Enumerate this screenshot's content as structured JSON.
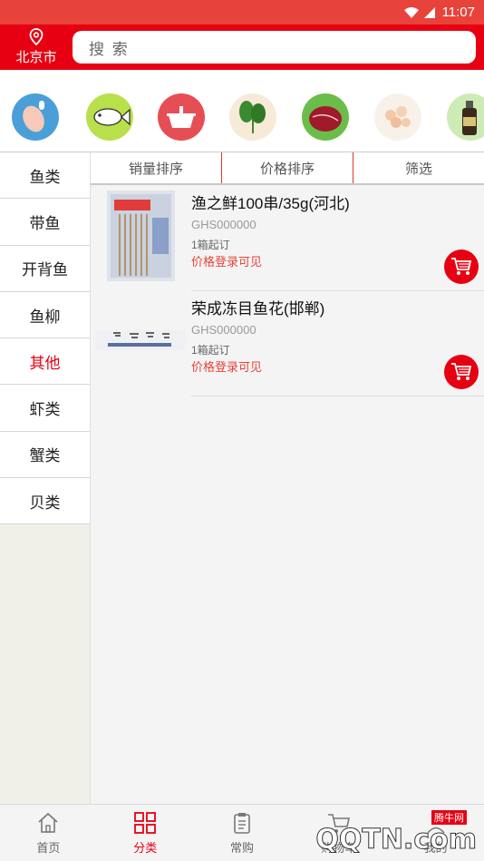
{
  "statusbar": {
    "time": "11:07"
  },
  "header": {
    "location": "北京市",
    "search_placeholder": "搜 索"
  },
  "categories_strip": [
    {
      "icon": "chicken-leg-icon"
    },
    {
      "icon": "fish-icon"
    },
    {
      "icon": "hotpot-icon"
    },
    {
      "icon": "vegetable-icon"
    },
    {
      "icon": "meat-icon"
    },
    {
      "icon": "shrimp-icon"
    },
    {
      "icon": "sauce-bottle-icon"
    }
  ],
  "sidebar": {
    "items": [
      {
        "label": "鱼类"
      },
      {
        "label": "带鱼"
      },
      {
        "label": "开背鱼"
      },
      {
        "label": "鱼柳"
      },
      {
        "label": "其他"
      },
      {
        "label": "虾类"
      },
      {
        "label": "蟹类"
      },
      {
        "label": "贝类"
      }
    ],
    "active_index": 4
  },
  "sort": {
    "sales": "销量排序",
    "price": "价格排序",
    "filter": "筛选"
  },
  "products": [
    {
      "title": "渔之鲜100串/35g(河北)",
      "code": "GHS000000",
      "moq": "1箱起订",
      "price_note": "价格登录可见"
    },
    {
      "title": "荣成冻目鱼花(邯郸)",
      "code": "GHS000000",
      "moq": "1箱起订",
      "price_note": "价格登录可见"
    }
  ],
  "tabbar": {
    "home": "首页",
    "category": "分类",
    "frequent": "常购",
    "cart": "购物车",
    "mine": "我的"
  },
  "watermark": {
    "site": "QQTN.com",
    "badge": "腾牛网"
  },
  "colors": {
    "brand": "#e60012",
    "status": "#e8433a",
    "price": "#e8433a"
  }
}
